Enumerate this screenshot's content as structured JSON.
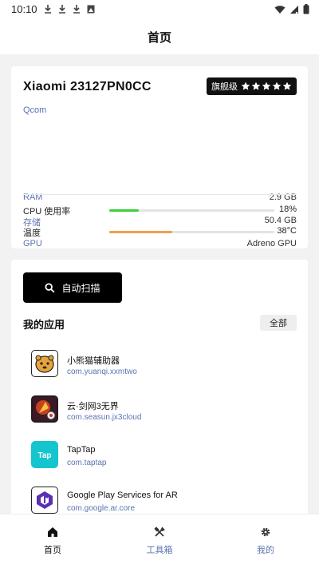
{
  "status_bar": {
    "time": "10:10"
  },
  "header": {
    "title": "首页"
  },
  "device": {
    "name": "Xiaomi 23127PN0CC",
    "badge_label": "旗舰级",
    "rating_stars": 5,
    "brand": "Qcom",
    "specs": [
      {
        "label": "RAM",
        "value": "2.9 GB"
      },
      {
        "label": "存储",
        "value": "50.4 GB"
      },
      {
        "label": "GPU",
        "value": "Adreno GPU"
      }
    ],
    "metrics": [
      {
        "label": "CPU 使用率",
        "value": "18%",
        "level": 0.18,
        "color": "#3ad13a"
      },
      {
        "label": "温度",
        "value": "38°C",
        "level": 0.38,
        "color": "#f0a04b"
      }
    ]
  },
  "apps_section": {
    "scan_button": "自动扫描",
    "title": "我的应用",
    "all_button": "全部",
    "apps": [
      {
        "name": "小熊猫辅助器",
        "package": "com.yuanqi.xxmtwo",
        "icon": "panda-app-icon"
      },
      {
        "name": "云·剑网3无界",
        "package": "com.seasun.jx3cloud",
        "icon": "jx3-app-icon"
      },
      {
        "name": "TapTap",
        "package": "com.taptap",
        "icon": "taptap-app-icon"
      },
      {
        "name": "Google Play Services for AR",
        "package": "com.google.ar.core",
        "icon": "arcore-app-icon"
      }
    ]
  },
  "bottom_nav": {
    "items": [
      {
        "label": "首页",
        "icon": "home-icon",
        "active": true
      },
      {
        "label": "工具箱",
        "icon": "tools-icon",
        "active": false
      },
      {
        "label": "我的",
        "icon": "gear-icon",
        "active": false
      }
    ]
  }
}
